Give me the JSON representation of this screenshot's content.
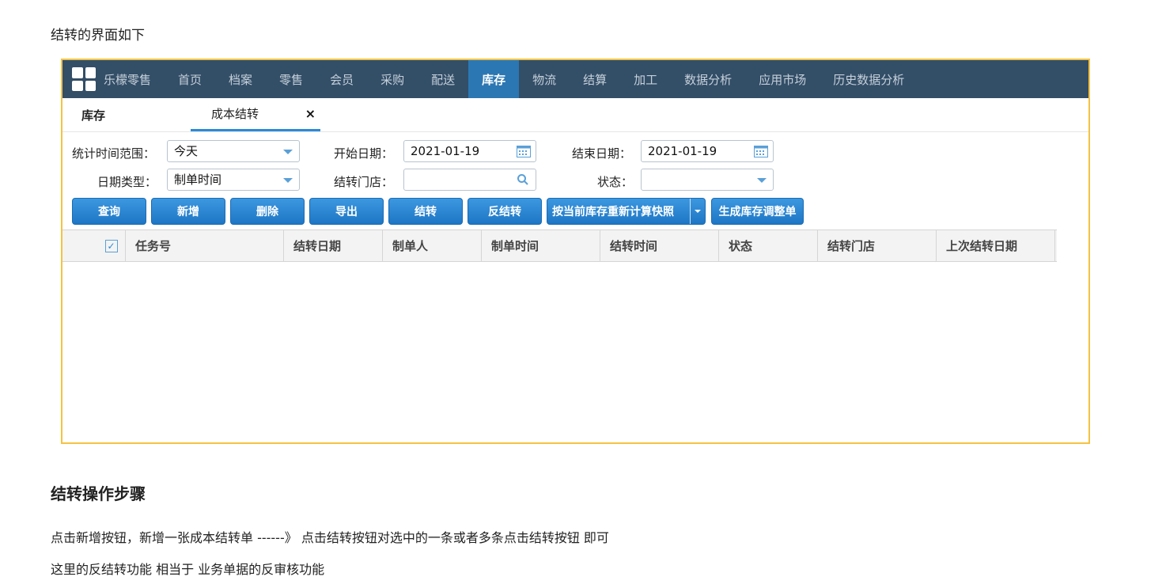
{
  "intro_text": "结转的界面如下",
  "topnav": {
    "brand": "乐檬零售",
    "items": [
      "首页",
      "档案",
      "零售",
      "会员",
      "采购",
      "配送",
      "库存",
      "物流",
      "结算",
      "加工",
      "数据分析",
      "应用市场",
      "历史数据分析"
    ],
    "active": "库存",
    "colors": {
      "bar": "#334e67",
      "active": "#2b77b3"
    }
  },
  "tabs": {
    "first": "库存",
    "second": "成本结转",
    "close": "×"
  },
  "filters": {
    "range_label": "统计时间范围：",
    "range_value": "今天",
    "start_label": "开始日期：",
    "start_value": "2021-01-19",
    "end_label": "结束日期：",
    "end_value": "2021-01-19",
    "datetype_label": "日期类型：",
    "datetype_value": "制单时间",
    "store_label": "结转门店：",
    "store_value": "",
    "status_label": "状态：",
    "status_value": ""
  },
  "buttons": {
    "query": "查询",
    "add": "新增",
    "delete": "删除",
    "export": "导出",
    "carry": "结转",
    "reverse": "反结转",
    "recalc": "按当前库存重新计算快照",
    "adjust": "生成库存调整单"
  },
  "grid": {
    "columns": [
      "任务号",
      "结转日期",
      "制单人",
      "制单时间",
      "结转时间",
      "状态",
      "结转门店",
      "上次结转日期"
    ]
  },
  "section_title": "结转操作步骤",
  "paragraphs": [
    "点击新增按钮，新增一张成本结转单 ------》 点击结转按钮对选中的一条或者多条点击结转按钮 即可",
    "这里的反结转功能 相当于 业务单据的反审核功能"
  ],
  "accent_color": "#f5c242"
}
